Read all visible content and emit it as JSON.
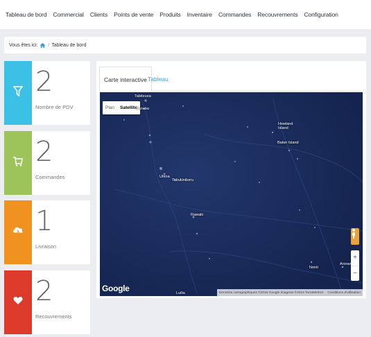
{
  "nav": {
    "items": [
      "Tableau de bord",
      "Commercial",
      "Clients",
      "Points de vente",
      "Produits",
      "Inventaire",
      "Commandes",
      "Recouvrements",
      "Configuration"
    ]
  },
  "breadcrumb": {
    "label": "Vous êtes ici:",
    "current": "Tableau de bord"
  },
  "stats": [
    {
      "number": "2",
      "label": "Nombre de PDV",
      "color": "#3cc0e6",
      "icon": "funnel-icon"
    },
    {
      "number": "2",
      "label": "Commandes",
      "color": "#9dc35b",
      "icon": "cart-icon"
    },
    {
      "number": "1",
      "label": "Livraison",
      "color": "#f0921f",
      "icon": "cloud-download-icon"
    },
    {
      "number": "2",
      "label": "Recouvrements",
      "color": "#dc3a2a",
      "icon": "heart-icon"
    }
  ],
  "map_panel": {
    "tabs": [
      "Carte interactive",
      "Tableau"
    ],
    "map_types": [
      "Plan",
      "Satellite"
    ],
    "places": [
      "Tabiteuea",
      "Banaba",
      "Utiroa",
      "Tabukiniberu",
      "Howland Island",
      "Baker Island",
      "Rawaki",
      "Nonti",
      "Nonti",
      "Arorae",
      "Luilia"
    ],
    "zoom_in": "+",
    "zoom_out": "−",
    "google": "Google",
    "attribution": "Données cartographiques ©2016 Google Imagerie ©2016 TerraMetrics",
    "terms": "Conditions d'utilisation"
  }
}
